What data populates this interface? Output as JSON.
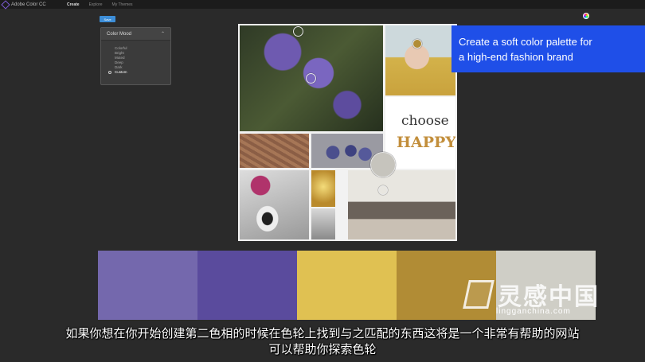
{
  "header": {
    "app_title": "Adobe Color CC",
    "nav": [
      {
        "label": "Create",
        "active": true
      },
      {
        "label": "Explore",
        "active": false
      },
      {
        "label": "My Themes",
        "active": false
      }
    ]
  },
  "toolbar": {
    "save_label": "Save"
  },
  "color_mood": {
    "title": "Color Mood",
    "options": [
      "Colorful",
      "Bright",
      "Muted",
      "Deep",
      "Dark",
      "Custom"
    ],
    "selected": "Custom"
  },
  "callout": {
    "line1": "Create a soft color palette for",
    "line2": "a high-end fashion brand"
  },
  "palette": [
    {
      "name": "swatch-lavender",
      "hex": "#7468ad"
    },
    {
      "name": "swatch-purple",
      "hex": "#5a4b9d"
    },
    {
      "name": "swatch-yellow",
      "hex": "#e0c152"
    },
    {
      "name": "swatch-gold",
      "hex": "#b18c35"
    },
    {
      "name": "swatch-stone",
      "hex": "#cfcec6"
    }
  ],
  "mug": {
    "line1": "choose",
    "line2": "HAPPY"
  },
  "subtitles": {
    "line1": "如果你想在你开始创建第二色相的时候在色轮上找到与之匹配的东西这将是一个非常有帮助的网站",
    "line2": "可以帮助你探索色轮"
  },
  "watermark": {
    "brand": "灵感中国",
    "url": "lingganchina.com"
  }
}
